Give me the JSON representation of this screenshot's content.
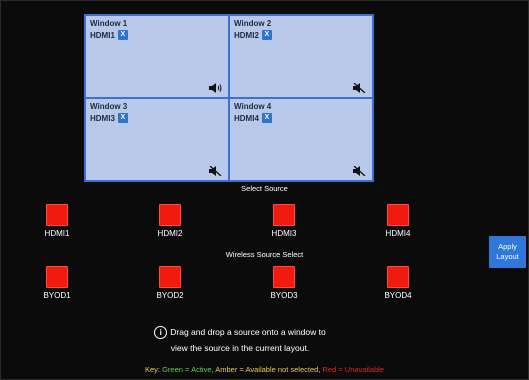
{
  "windows": [
    {
      "title": "Window 1",
      "source": "HDMI1",
      "remove": "X",
      "muted": false
    },
    {
      "title": "Window 2",
      "source": "HDMI2",
      "remove": "X",
      "muted": true
    },
    {
      "title": "Window 3",
      "source": "HDMI3",
      "remove": "X",
      "muted": true
    },
    {
      "title": "Window 4",
      "source": "HDMI4",
      "remove": "X",
      "muted": true
    }
  ],
  "select_source_title": "Select Source",
  "wired_sources": [
    "HDMI1",
    "HDMI2",
    "HDMI3",
    "HDMI4"
  ],
  "wireless_title": "Wireless Source Select",
  "wireless_sources": [
    "BYOD1",
    "BYOD2",
    "BYOD3",
    "BYOD4"
  ],
  "apply_label": "Apply\nLayout",
  "info_line1": "Drag and drop a source onto a window to",
  "info_line2": "view the source in the current layout.",
  "key": {
    "prefix": "Key: ",
    "green": "Green = Active,",
    "amber": " Amber = Available not selected,",
    "red": " Red = Unavailable"
  },
  "colors": {
    "source_unavailable": "#f11a0f",
    "apply_button": "#2f77d8",
    "window_bg": "#b7c8e8",
    "key_green": "#5fd04a",
    "key_amber": "#f2c94c",
    "key_red": "#e5231b"
  }
}
